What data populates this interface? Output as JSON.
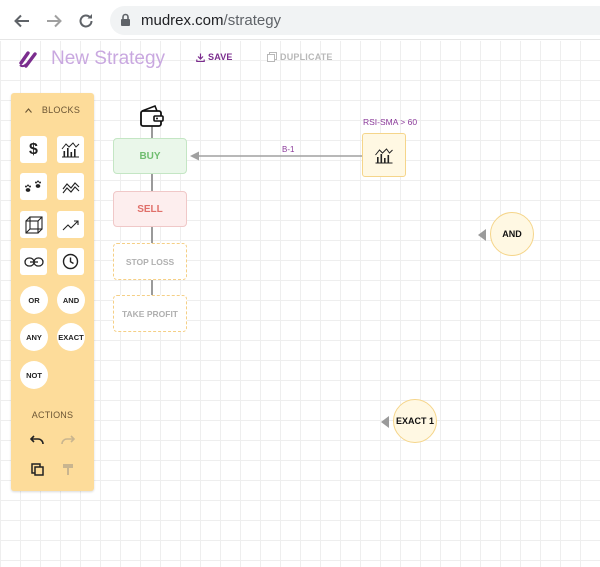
{
  "browser": {
    "url_host": "mudrex.com",
    "url_path": "/strategy"
  },
  "header": {
    "strategy_name": "New Strategy",
    "save_label": "SAVE",
    "duplicate_label": "DUPLICATE"
  },
  "blocks_panel": {
    "title": "BLOCKS",
    "icon_blocks": [
      "dollar-icon",
      "chart-bars-icon",
      "paw-icon",
      "zigzag-icon",
      "cube-icon",
      "trend-up-icon",
      "link-icon",
      "clock-icon"
    ],
    "logic_blocks": [
      "OR",
      "AND",
      "ANY",
      "EXACT",
      "NOT"
    ],
    "actions_title": "ACTIONS"
  },
  "flow": {
    "buy_label": "BUY",
    "sell_label": "SELL",
    "stop_loss_label": "STOP LOSS",
    "take_profit_label": "TAKE PROFIT",
    "indicator_label": "RSI-SMA > 60",
    "edge_label": "B-1",
    "and_node_label": "AND",
    "exact_node_label": "EXACT 1"
  },
  "colors": {
    "brand_purple": "#7b2d8e",
    "panel_bg": "#fddc9a",
    "buy_green": "#6fbd6f",
    "sell_red": "#e0706a"
  }
}
